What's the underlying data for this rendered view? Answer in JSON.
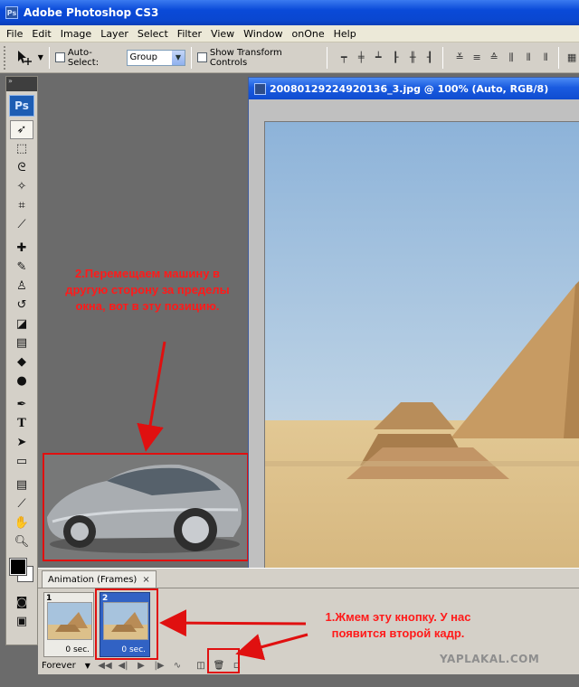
{
  "app": {
    "title": "Adobe Photoshop CS3"
  },
  "menu": [
    "File",
    "Edit",
    "Image",
    "Layer",
    "Select",
    "Filter",
    "View",
    "Window",
    "onOne",
    "Help"
  ],
  "options": {
    "auto_select_label": "Auto-Select:",
    "auto_select_value": "Group",
    "show_transform_label": "Show Transform Controls"
  },
  "toolbox": {
    "logo": "Ps"
  },
  "document": {
    "title": "20080129224920136_3.jpg @ 100% (Auto, RGB/8)"
  },
  "animation": {
    "tab_label": "Animation (Frames)",
    "tab_close": "×",
    "frames": [
      {
        "num": "1",
        "delay": "0 sec."
      },
      {
        "num": "2",
        "delay": "0 sec."
      }
    ],
    "loop": "Forever"
  },
  "annotations": {
    "note2": "2.Перемещаем машину в другую сторону за пределы окна, вот в эту позицию.",
    "note1": "1.Жмем эту кнопку. У нас появится второй кадр."
  },
  "watermark": "YAPLAKAL.COM",
  "colors": {
    "accent_red": "#e01010",
    "xp_blue": "#0a4ad8",
    "panel_gray": "#d4d0c8"
  }
}
